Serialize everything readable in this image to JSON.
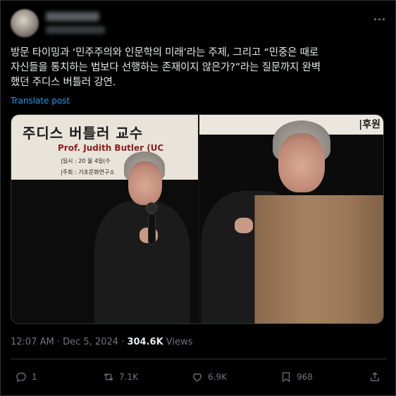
{
  "tweet": {
    "text_line1": "방문 타이밍과 ‘민주주의와 인문학의 미래’라는 주제, 그리고 “민중은 때로",
    "text_line2": "자신들을 통치하는 법보다 선행하는 존재이지 않은가?”라는 질문까지 완벽",
    "text_line3": "했던 주디스 버틀러 강연.",
    "translate_label": "Translate post",
    "time": "12:07 AM",
    "separator": " · ",
    "date": "Dec 5, 2024",
    "views_count": "304.6K",
    "views_label": " Views"
  },
  "media": {
    "left_banner_title": "주디스 버틀러 교수 ",
    "left_banner_sub": "Prof. Judith Butler (UC",
    "left_banner_line1": "|일시 : 20           월 4일(수",
    "left_banner_line2": "|주최 :                  기초문화연구소",
    "right_banner_text": "|후원"
  },
  "actions": {
    "replies": "1",
    "reposts": "7.1K",
    "likes": "6.9K",
    "bookmarks": "968"
  },
  "colors": {
    "background": "#000000",
    "text": "#e7e9ea",
    "muted": "#71767b",
    "link": "#1d9bf0",
    "border": "#2f3336"
  }
}
